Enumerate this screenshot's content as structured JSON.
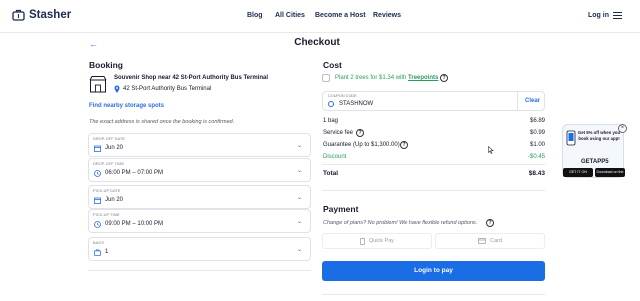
{
  "header": {
    "brand": "Stasher",
    "nav": [
      "Blog",
      "All Cities",
      "Become a Host",
      "Reviews"
    ],
    "login": "Log in"
  },
  "page": {
    "title": "Checkout"
  },
  "booking": {
    "heading": "Booking",
    "shop_name": "Souvenir Shop near 42 St-Port Authority Bus Terminal",
    "address": "42 St-Port Authority Bus Terminal",
    "nearby_link": "Find nearby storage spots",
    "address_note": "The exact address is shared once the booking is confirmed.",
    "fields": [
      {
        "label": "DROP-OFF DATE",
        "value": "Jun 20"
      },
      {
        "label": "DROP-OFF TIME",
        "value": "06:00 PM – 07:00 PM"
      },
      {
        "label": "PICK-UP DATE",
        "value": "Jun 20"
      },
      {
        "label": "PICK-UP TIME",
        "value": "09:00 PM – 10:00 PM"
      },
      {
        "label": "BAGS",
        "value": "1"
      }
    ]
  },
  "cost": {
    "heading": "Cost",
    "tree_text": "Plant 2 trees for $1.34 with ",
    "tree_link": "Treepoints",
    "coupon_label": "COUPON CODE",
    "coupon_value": "STASHNOW",
    "coupon_clear": "Clear",
    "rows": [
      {
        "label": "1 bag",
        "value": "$6.89"
      },
      {
        "label": "Service fee",
        "value": "$0.99"
      },
      {
        "label": "Guarantee (Up to $1,300.00)",
        "value": "$1.00"
      },
      {
        "label": "Discount",
        "value": "-$0.45"
      },
      {
        "label": "Total",
        "value": "$8.43"
      }
    ]
  },
  "payment": {
    "heading": "Payment",
    "note": "Change of plans? No problem! We have flexible refund options.",
    "options": [
      "Quick Pay",
      "Card"
    ],
    "cta": "Login to pay"
  },
  "promo": {
    "text": "Get 5% off when you book using our app!",
    "code": "GETAPP5",
    "google": "GET IT ON Google Play",
    "apple": "Download on the App Store"
  },
  "colors": {
    "accent": "#1a6de4",
    "green": "#2a9d5c",
    "text": "#1a1a2e"
  }
}
